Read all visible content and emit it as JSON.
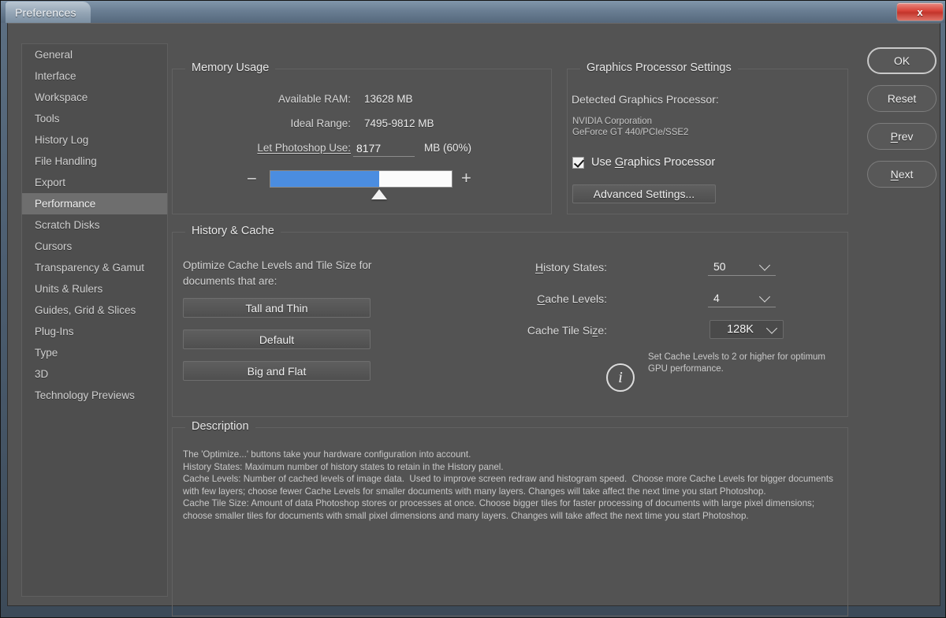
{
  "window": {
    "title": "Preferences",
    "close_label": "x"
  },
  "sidebar": {
    "items": [
      {
        "label": "General",
        "selected": false
      },
      {
        "label": "Interface",
        "selected": false
      },
      {
        "label": "Workspace",
        "selected": false
      },
      {
        "label": "Tools",
        "selected": false
      },
      {
        "label": "History Log",
        "selected": false
      },
      {
        "label": "File Handling",
        "selected": false
      },
      {
        "label": "Export",
        "selected": false
      },
      {
        "label": "Performance",
        "selected": true
      },
      {
        "label": "Scratch Disks",
        "selected": false
      },
      {
        "label": "Cursors",
        "selected": false
      },
      {
        "label": "Transparency & Gamut",
        "selected": false
      },
      {
        "label": "Units & Rulers",
        "selected": false
      },
      {
        "label": "Guides, Grid & Slices",
        "selected": false
      },
      {
        "label": "Plug-Ins",
        "selected": false
      },
      {
        "label": "Type",
        "selected": false
      },
      {
        "label": "3D",
        "selected": false
      },
      {
        "label": "Technology Previews",
        "selected": false
      }
    ]
  },
  "memory_usage": {
    "legend": "Memory Usage",
    "available_ram_label": "Available RAM:",
    "available_ram_value": "13628 MB",
    "ideal_range_label": "Ideal Range:",
    "ideal_range_value": "7495-9812 MB",
    "let_use_label": "Let Photoshop Use:",
    "let_use_value": "8177",
    "unit_label": "MB (60%)",
    "slider_percent": 60,
    "minus_label": "−",
    "plus_label": "+",
    "fill_color": "#4b8de0"
  },
  "graphics_processor": {
    "legend": "Graphics Processor Settings",
    "detected_label": "Detected Graphics Processor:",
    "vendor": "NVIDIA Corporation",
    "model": "GeForce GT 440/PCIe/SSE2",
    "use_gpu_label": "Use Graphics Processor",
    "use_gpu_checked": true,
    "advanced_button": "Advanced Settings..."
  },
  "history_cache": {
    "legend": "History & Cache",
    "optimize_hint": "Optimize Cache Levels and Tile Size for documents that are:",
    "buttons": {
      "tall": "Tall and Thin",
      "default": "Default",
      "big": "Big and Flat"
    },
    "history_states_label": "History States:",
    "history_states_value": "50",
    "cache_levels_label": "Cache Levels:",
    "cache_levels_value": "4",
    "cache_tile_label": "Cache Tile Size:",
    "cache_tile_value": "128K",
    "info_glyph": "i",
    "info_text": "Set Cache Levels to 2 or higher for optimum GPU performance."
  },
  "description": {
    "legend": "Description",
    "body": "The 'Optimize...' buttons take your hardware configuration into account.\nHistory States: Maximum number of history states to retain in the History panel.\nCache Levels: Number of cached levels of image data.  Used to improve screen redraw and histogram speed.  Choose more Cache Levels for bigger documents with few layers; choose fewer Cache Levels for smaller documents with many layers. Changes will take affect the next time you start Photoshop.\nCache Tile Size: Amount of data Photoshop stores or processes at once. Choose bigger tiles for faster processing of documents with large pixel dimensions; choose smaller tiles for documents with small pixel dimensions and many layers. Changes will take affect the next time you start Photoshop."
  },
  "actions": {
    "ok": "OK",
    "reset": "Reset",
    "prev": "Prev",
    "next": "Next"
  }
}
